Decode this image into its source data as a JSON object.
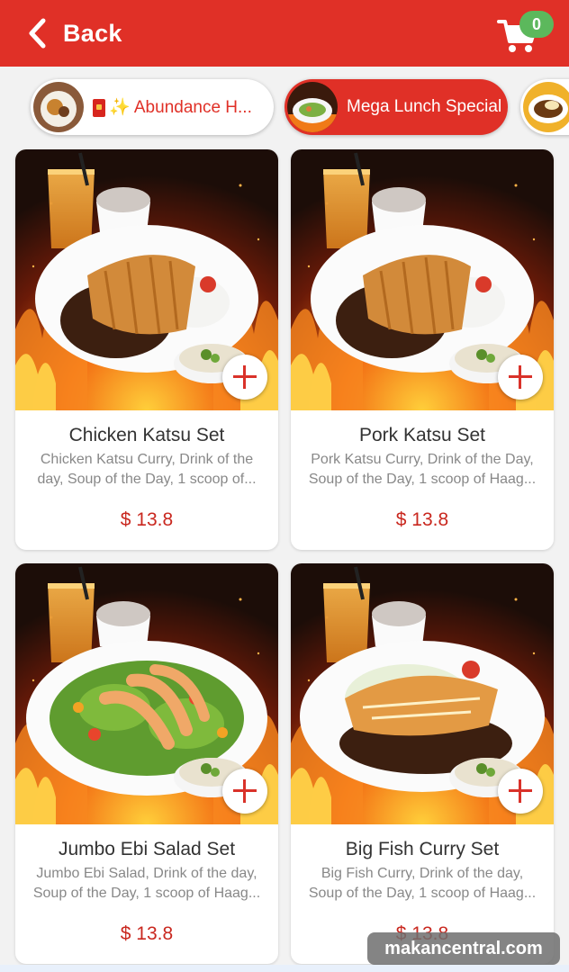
{
  "header": {
    "back_label": "Back",
    "cart_count": "0"
  },
  "categories": [
    {
      "label": "✨ Abundance H...",
      "active": false
    },
    {
      "label": "Mega Lunch Special",
      "active": true
    },
    {
      "label": "",
      "active": false
    }
  ],
  "items": [
    {
      "name": "Chicken Katsu Set",
      "description": "Chicken Katsu Curry, Drink of the day, Soup of the Day, 1 scoop of...",
      "price": "$ 13.8"
    },
    {
      "name": "Pork Katsu Set",
      "description": "Pork Katsu Curry, Drink of the Day, Soup of the Day, 1 scoop of Haag...",
      "price": "$ 13.8"
    },
    {
      "name": "Jumbo Ebi Salad Set",
      "description": "Jumbo Ebi Salad, Drink of the day, Soup of the Day, 1 scoop of Haag...",
      "price": "$ 13.8"
    },
    {
      "name": "Big Fish Curry Set",
      "description": "Big Fish Curry, Drink of the day, Soup of the Day, 1 scoop of Haag...",
      "price": "$ 13.8"
    }
  ],
  "watermark": "makancentral.com",
  "colors": {
    "brand_red": "#e03027",
    "price_red": "#c9281f",
    "badge_green": "#5cb85c"
  },
  "icons": [
    "back-chevron-icon",
    "cart-icon",
    "plus-icon",
    "red-envelope-icon"
  ]
}
